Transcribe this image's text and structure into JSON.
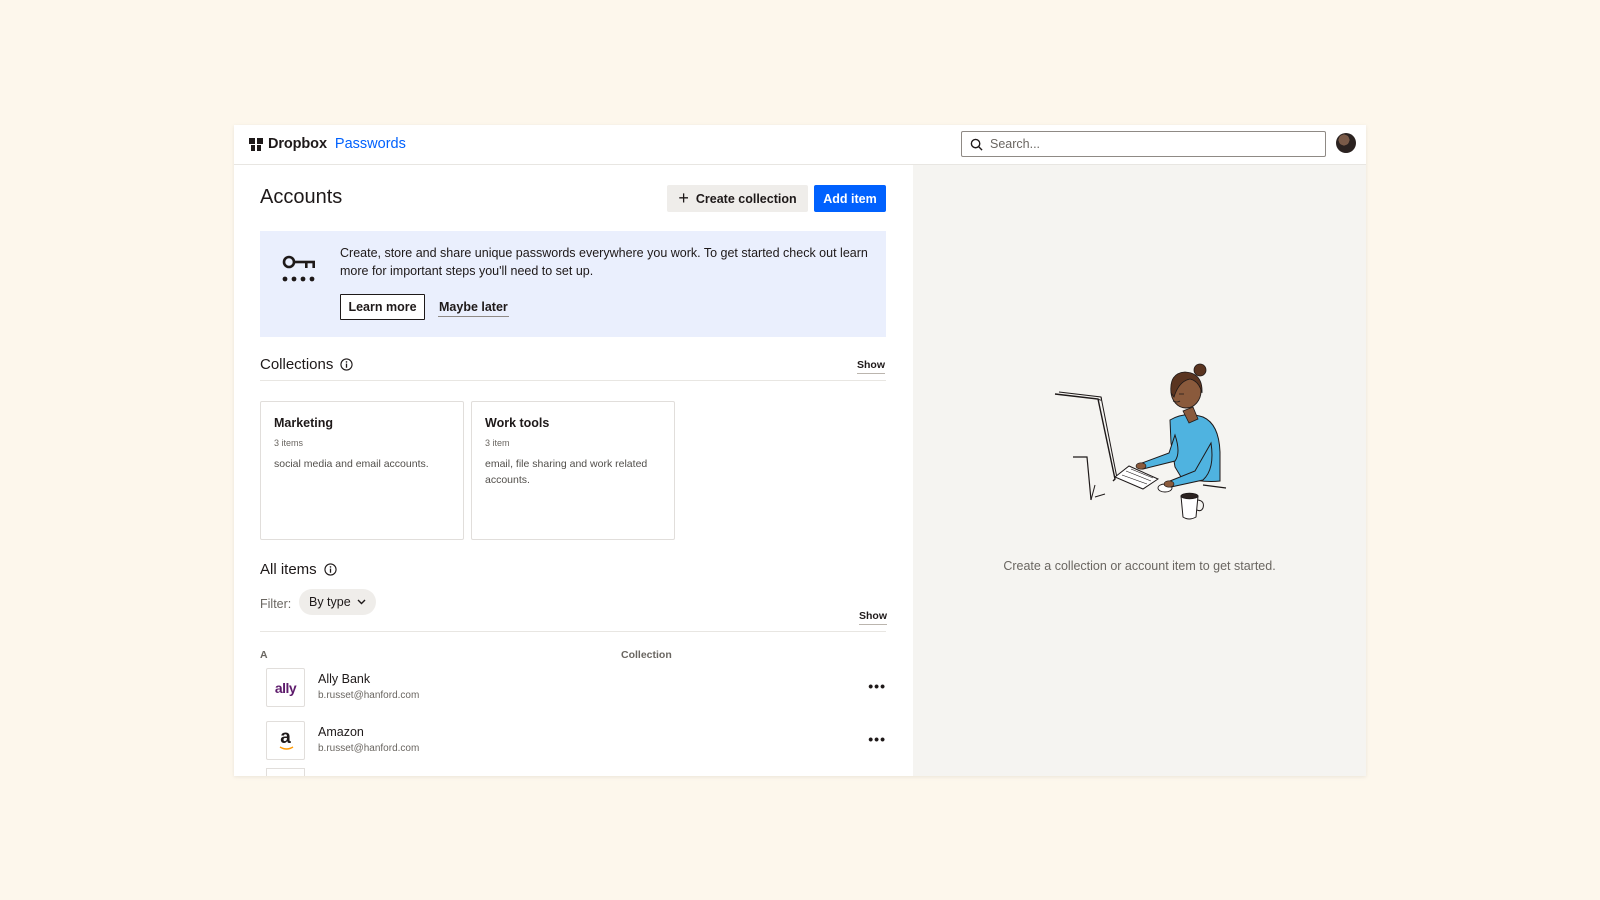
{
  "app": {
    "brand": "Dropbox",
    "product": "Passwords",
    "accent_color": "#0061fe"
  },
  "search": {
    "placeholder": "Search..."
  },
  "header": {
    "title": "Accounts",
    "create_collection_label": "Create collection",
    "add_item_label": "Add item"
  },
  "banner": {
    "text": "Create, store and share unique passwords everywhere you work. To get started check out learn more for important steps you'll need to set up.",
    "learn_more_label": "Learn more",
    "maybe_later_label": "Maybe later"
  },
  "collections": {
    "title": "Collections",
    "show_label": "Show",
    "items": [
      {
        "name": "Marketing",
        "count": "3 items",
        "description": "social media and email accounts."
      },
      {
        "name": "Work tools",
        "count": "3 item",
        "description": "email, file sharing and work related accounts."
      }
    ]
  },
  "all_items": {
    "title": "All items",
    "filter_label": "Filter:",
    "filter_value": "By type",
    "show_label": "Show",
    "columns": {
      "group": "A",
      "collection": "Collection"
    },
    "rows": [
      {
        "name": "Ally Bank",
        "email": "b.russet@hanford.com",
        "logo": "ally",
        "logo_color": "#5d1a6b",
        "more": "•••"
      },
      {
        "name": "Amazon",
        "email": "b.russet@hanford.com",
        "logo": "a",
        "logo_color": "#1e1919",
        "more": "•••"
      }
    ]
  },
  "empty_state": {
    "text": "Create a collection or account item to get started."
  }
}
